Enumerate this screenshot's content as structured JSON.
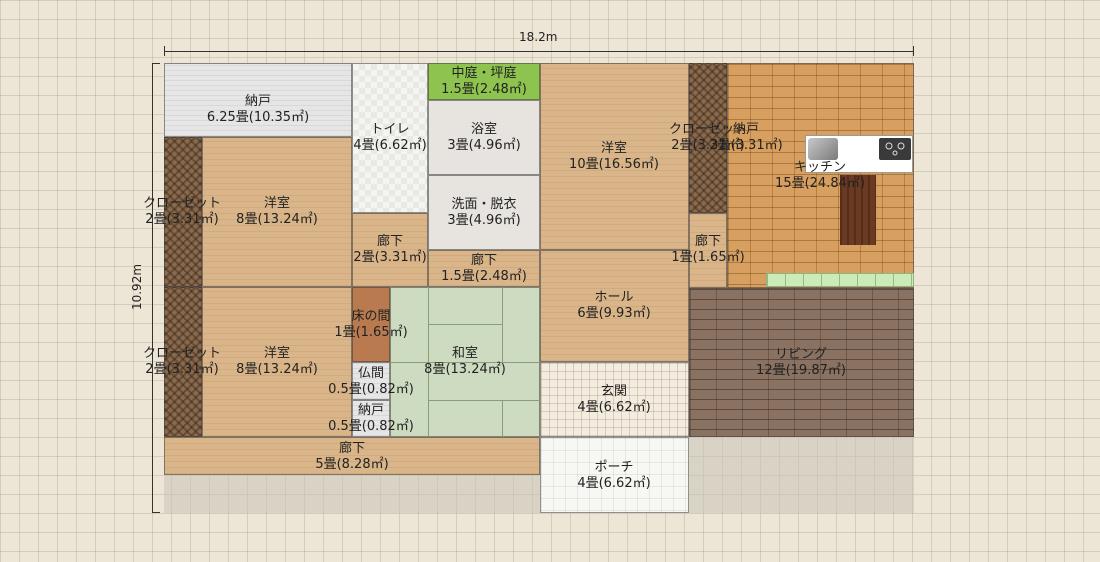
{
  "dimensions": {
    "width": "18.2m",
    "height": "10.92m"
  },
  "rooms": {
    "nando_top": {
      "name": "納戸",
      "area": "6.25畳(10.35㎡)"
    },
    "toilet": {
      "name": "トイレ",
      "area": "4畳(6.62㎡)"
    },
    "courtyard": {
      "name": "中庭・坪庭",
      "area": "1.5畳(2.48㎡)"
    },
    "bath": {
      "name": "浴室",
      "area": "3畳(4.96㎡)"
    },
    "washroom": {
      "name": "洗面・脱衣",
      "area": "3畳(4.96㎡)"
    },
    "western_center": {
      "name": "洋室",
      "area": "10畳(16.56㎡)"
    },
    "closet_center": {
      "name": "クローゼット",
      "area": "2畳(3.31㎡)"
    },
    "nando_right": {
      "name": "納戸",
      "area": "2畳(3.31㎡)"
    },
    "kitchen": {
      "name": "キッチン",
      "area": "15畳(24.84㎡)"
    },
    "closet_left_1": {
      "name": "クローゼット",
      "area": "2畳(3.31㎡)"
    },
    "western_left_1": {
      "name": "洋室",
      "area": "8畳(13.24㎡)"
    },
    "hall_mid_1": {
      "name": "廊下",
      "area": "2畳(3.31㎡)"
    },
    "hall_mid_2": {
      "name": "廊下",
      "area": "1.5畳(2.48㎡)"
    },
    "hall_right": {
      "name": "廊下",
      "area": "1畳(1.65㎡)"
    },
    "hall_main": {
      "name": "ホール",
      "area": "6畳(9.93㎡)"
    },
    "closet_left_2": {
      "name": "クローゼット",
      "area": "2畳(3.31㎡)"
    },
    "western_left_2": {
      "name": "洋室",
      "area": "8畳(13.24㎡)"
    },
    "tokonoma": {
      "name": "床の間",
      "area": "1畳(1.65㎡)"
    },
    "washitsu": {
      "name": "和室",
      "area": "8畳(13.24㎡)"
    },
    "butsuma": {
      "name": "仏間",
      "area": "0.5畳(0.82㎡)"
    },
    "nando_small": {
      "name": "納戸",
      "area": "0.5畳(0.82㎡)"
    },
    "genkan": {
      "name": "玄関",
      "area": "4畳(6.62㎡)"
    },
    "living": {
      "name": "リビング",
      "area": "12畳(19.87㎡)"
    },
    "hall_bottom": {
      "name": "廊下",
      "area": "5畳(8.28㎡)"
    },
    "porch": {
      "name": "ポーチ",
      "area": "4畳(6.62㎡)"
    }
  },
  "colors": {
    "background": "#ede6d6",
    "courtyard": "#8fc34f",
    "tatami": "#cddcc0",
    "kitchen_floor": "#d7a060",
    "living_floor": "#8a7262",
    "closet": "#8a6a4e"
  }
}
